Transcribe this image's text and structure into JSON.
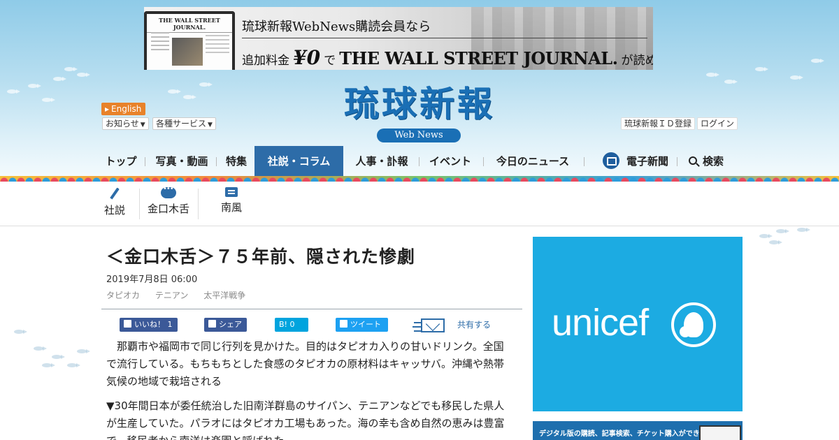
{
  "banner": {
    "line1": "琉球新報WebNews購読会員なら",
    "line2_prefix": "追加料金",
    "line2_price": "¥0",
    "line2_de": "で",
    "line2_brand": "THE WALL STREET JOURNAL.",
    "line2_suffix": "が読める",
    "laptop_masthead": "THE WALL STREET JOURNAL."
  },
  "header": {
    "logo": "琉球新報",
    "subtitle": "Web News",
    "english": "English",
    "notices": "お知らせ",
    "services": "各種サービス",
    "register": "琉球新報ＩＤ登録",
    "login": "ログイン"
  },
  "nav": {
    "items": [
      "トップ",
      "写真・動画",
      "特集",
      "社説・コラム",
      "人事・訃報",
      "イベント",
      "今日のニュース"
    ],
    "paper": "電子新聞",
    "search": "検索"
  },
  "subnav": {
    "items": [
      "社説",
      "金口木舌",
      "南風"
    ]
  },
  "article": {
    "headline": "＜金口木舌＞７５年前、隠された惨劇",
    "date": "2019年7月8日 06:00",
    "tags": [
      "タピオカ",
      "テニアン",
      "太平洋戦争"
    ],
    "para1": "那覇市や福岡市で同じ行列を見かけた。目的はタピオカ入りの甘いドリンク。全国で流行している。もちもちとした食感のタピオカの原材料はキャッサバ。沖縄や熱帯気候の地域で栽培される",
    "para2": "▼30年間日本が委任統治した旧南洋群島のサイパン、テニアンなどでも移民した県人が生産していた。パラオにはタピオカ工場もあった。海の幸も含め自然の恵みは豊富で、移民者から南洋は楽園と呼ばれた"
  },
  "share": {
    "like": "いいね！ 1",
    "fb_share": "シェア",
    "hatena": "B! 0",
    "tweet": "ツイート",
    "share_all": "共有する"
  },
  "sidebar": {
    "ad_brand": "unicef",
    "promo_text": "デジタル版の購読、記事検索、チケット購入ができる"
  },
  "colors": {
    "brand_blue": "#1a6fb5",
    "nav_active": "#2d6ca8",
    "unicef": "#1cabe2",
    "english_orange": "#e8822a"
  }
}
